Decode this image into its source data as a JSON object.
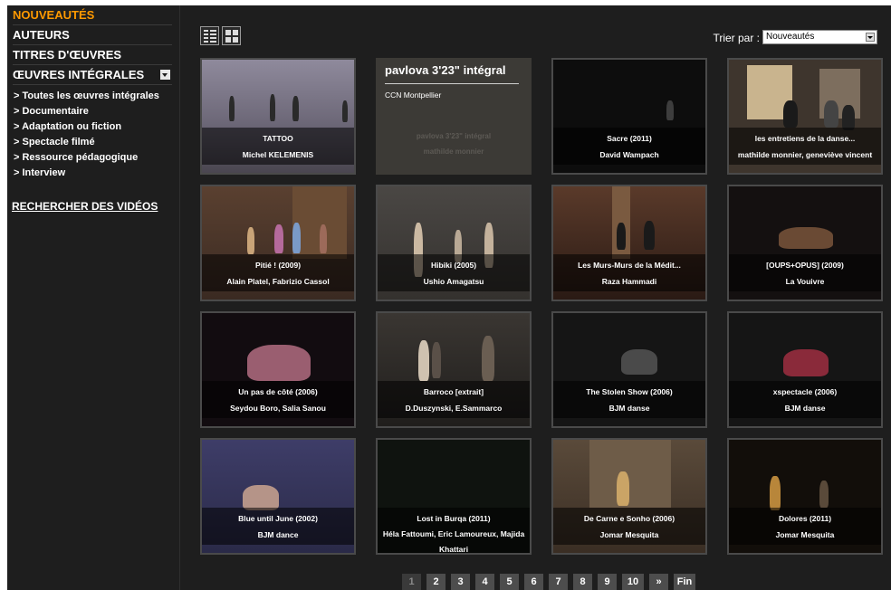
{
  "sidebar": {
    "menu": [
      {
        "label": "NOUVEAUTÉS"
      },
      {
        "label": "AUTEURS"
      },
      {
        "label": "TITRES D'ŒUVRES"
      },
      {
        "label": "ŒUVRES INTÉGRALES"
      }
    ],
    "submenu": [
      {
        "label": "> Toutes les œuvres intégrales"
      },
      {
        "label": "> Documentaire"
      },
      {
        "label": "> Adaptation ou fiction"
      },
      {
        "label": "> Spectacle filmé"
      },
      {
        "label": "> Ressource pédagogique"
      },
      {
        "label": "> Interview"
      }
    ],
    "search_link": "RECHERCHER DES VIDÉOS"
  },
  "toolbar": {
    "sort_label": "Trier par :",
    "sort_value": "Nouveautés"
  },
  "featured": {
    "title": "pavlova 3'23\" intégral",
    "subtitle": "CCN Montpellier",
    "ghost_line1": "pavlova 3'23\" intégral",
    "ghost_line2": "mathilde monnier"
  },
  "videos": [
    {
      "title": "TATTOO",
      "author": "Michel KELEMENIS"
    },
    {
      "title": "pavlova 3'23\" intégral",
      "author": "mathilde monnier"
    },
    {
      "title": "Sacre (2011)",
      "author": "David Wampach"
    },
    {
      "title": "les entretiens de la danse...",
      "author": "mathilde monnier, geneviève vincent"
    },
    {
      "title": "Pitié ! (2009)",
      "author": "Alain Platel, Fabrizio Cassol"
    },
    {
      "title": "Hibiki (2005)",
      "author": "Ushio Amagatsu"
    },
    {
      "title": "Les Murs-Murs de la Médit...",
      "author": "Raza Hammadi"
    },
    {
      "title": "[OUPS+OPUS] (2009)",
      "author": "La Vouivre"
    },
    {
      "title": "Un pas de côté (2006)",
      "author": "Seydou Boro, Salia Sanou"
    },
    {
      "title": "Barroco [extrait]",
      "author": "D.Duszynski, E.Sammarco"
    },
    {
      "title": "The Stolen Show (2006)",
      "author": "BJM danse"
    },
    {
      "title": "xspectacle (2006)",
      "author": "BJM danse"
    },
    {
      "title": "Blue until June (2002)",
      "author": "BJM dance"
    },
    {
      "title": "Lost in Burqa (2011)",
      "author": "Héla Fattoumi, Eric Lamoureux, Majida Khattari"
    },
    {
      "title": "De Carne e Sonho (2006)",
      "author": "Jomar Mesquita"
    },
    {
      "title": "Dolores (2011)",
      "author": "Jomar Mesquita"
    }
  ],
  "pagination": [
    "1",
    "2",
    "3",
    "4",
    "5",
    "6",
    "7",
    "8",
    "9",
    "10",
    "»",
    "Fin"
  ]
}
